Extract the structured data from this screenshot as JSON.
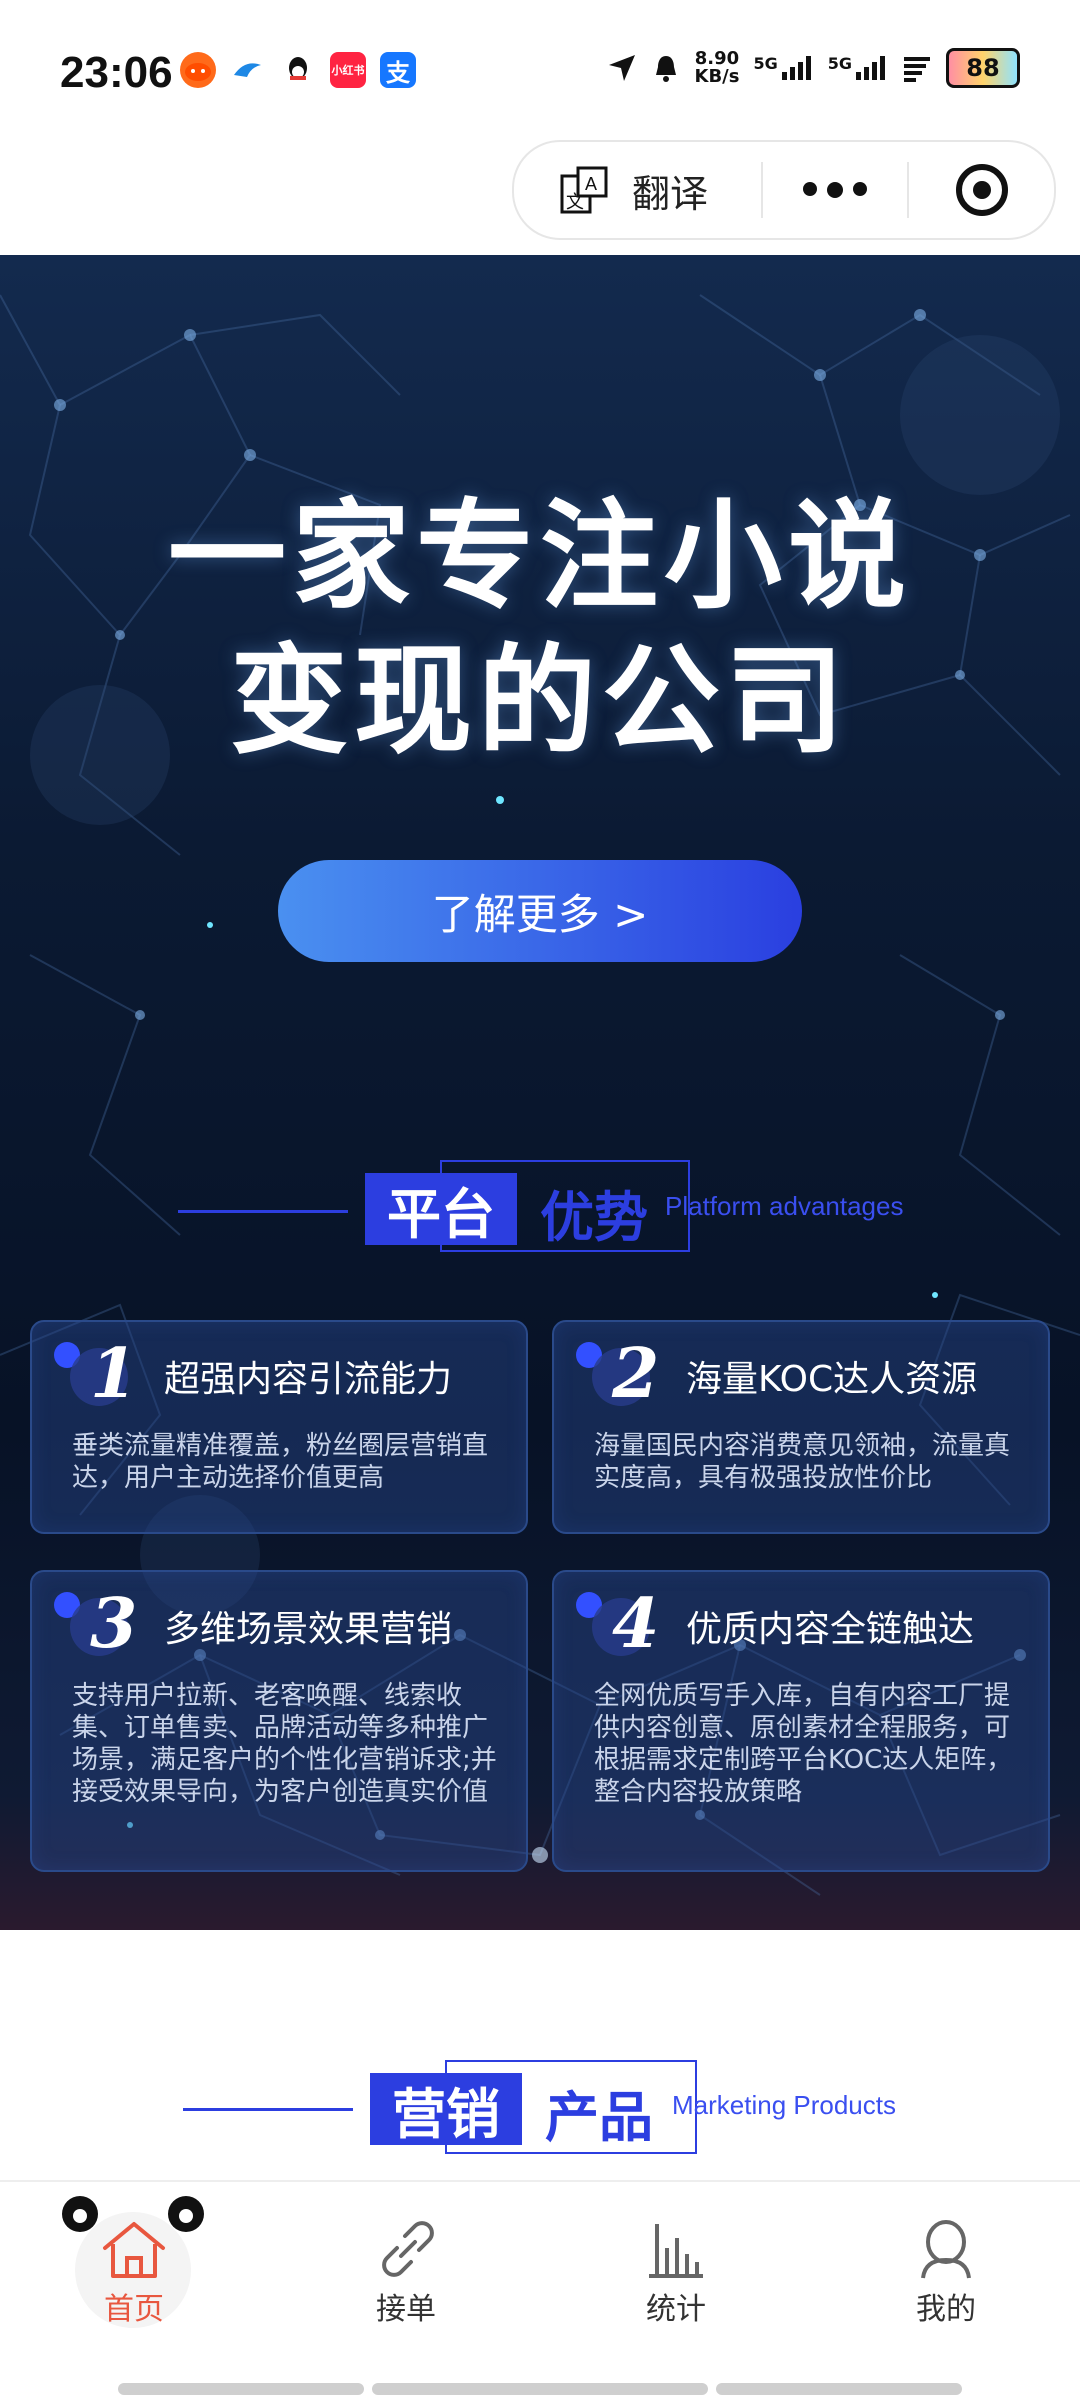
{
  "status_bar": {
    "time": "23:06",
    "app_icons": [
      "taobao-icon",
      "bird-icon",
      "qq-icon",
      "xiaohongshu-icon",
      "alipay-icon"
    ],
    "xiaohongshu_label": "小红书",
    "alipay_label": "支",
    "net_speed_value": "8.90",
    "net_speed_unit": "KB/s",
    "signal1": "5G",
    "signal2": "5G",
    "battery": "88"
  },
  "capsule": {
    "translate_label": "翻译"
  },
  "hero": {
    "headline_line1": "一家专注小说",
    "headline_line2": "变现的公司",
    "cta_label": "了解更多 >"
  },
  "advantages_section": {
    "title_part1": "平台",
    "title_part2": "优势",
    "title_en": "Platform advantages",
    "cards": [
      {
        "number": "1",
        "title": "超强内容引流能力",
        "desc": "垂类流量精准覆盖，粉丝圈层营销直达，用户主动选择价值更高"
      },
      {
        "number": "2",
        "title": "海量KOC达人资源",
        "desc": "海量国民内容消费意见领袖，流量真实度高，具有极强投放性价比"
      },
      {
        "number": "3",
        "title": "多维场景效果营销",
        "desc": "支持用户拉新、老客唤醒、线索收集、订单售卖、品牌活动等多种推广场景，满足客户的个性化营销诉求;并接受效果导向，为客户创造真实价值"
      },
      {
        "number": "4",
        "title": "优质内容全链触达",
        "desc": "全网优质写手入库，自有内容工厂提供内容创意、原创素材全程服务，可根据需求定制跨平台KOC达人矩阵，整合内容投放策略"
      }
    ]
  },
  "marketing_section": {
    "title_part1": "营销",
    "title_part2": "产品",
    "title_en": "Marketing Products"
  },
  "tabbar": {
    "items": [
      {
        "label": "首页",
        "icon": "home-icon",
        "active": true
      },
      {
        "label": "接单",
        "icon": "link-icon",
        "active": false
      },
      {
        "label": "统计",
        "icon": "bar-chart-icon",
        "active": false
      },
      {
        "label": "我的",
        "icon": "user-icon",
        "active": false
      }
    ]
  },
  "colors": {
    "accent": "#2c3ee0",
    "active_tab": "#e8573f",
    "hero_bg": "#0b1a33"
  }
}
